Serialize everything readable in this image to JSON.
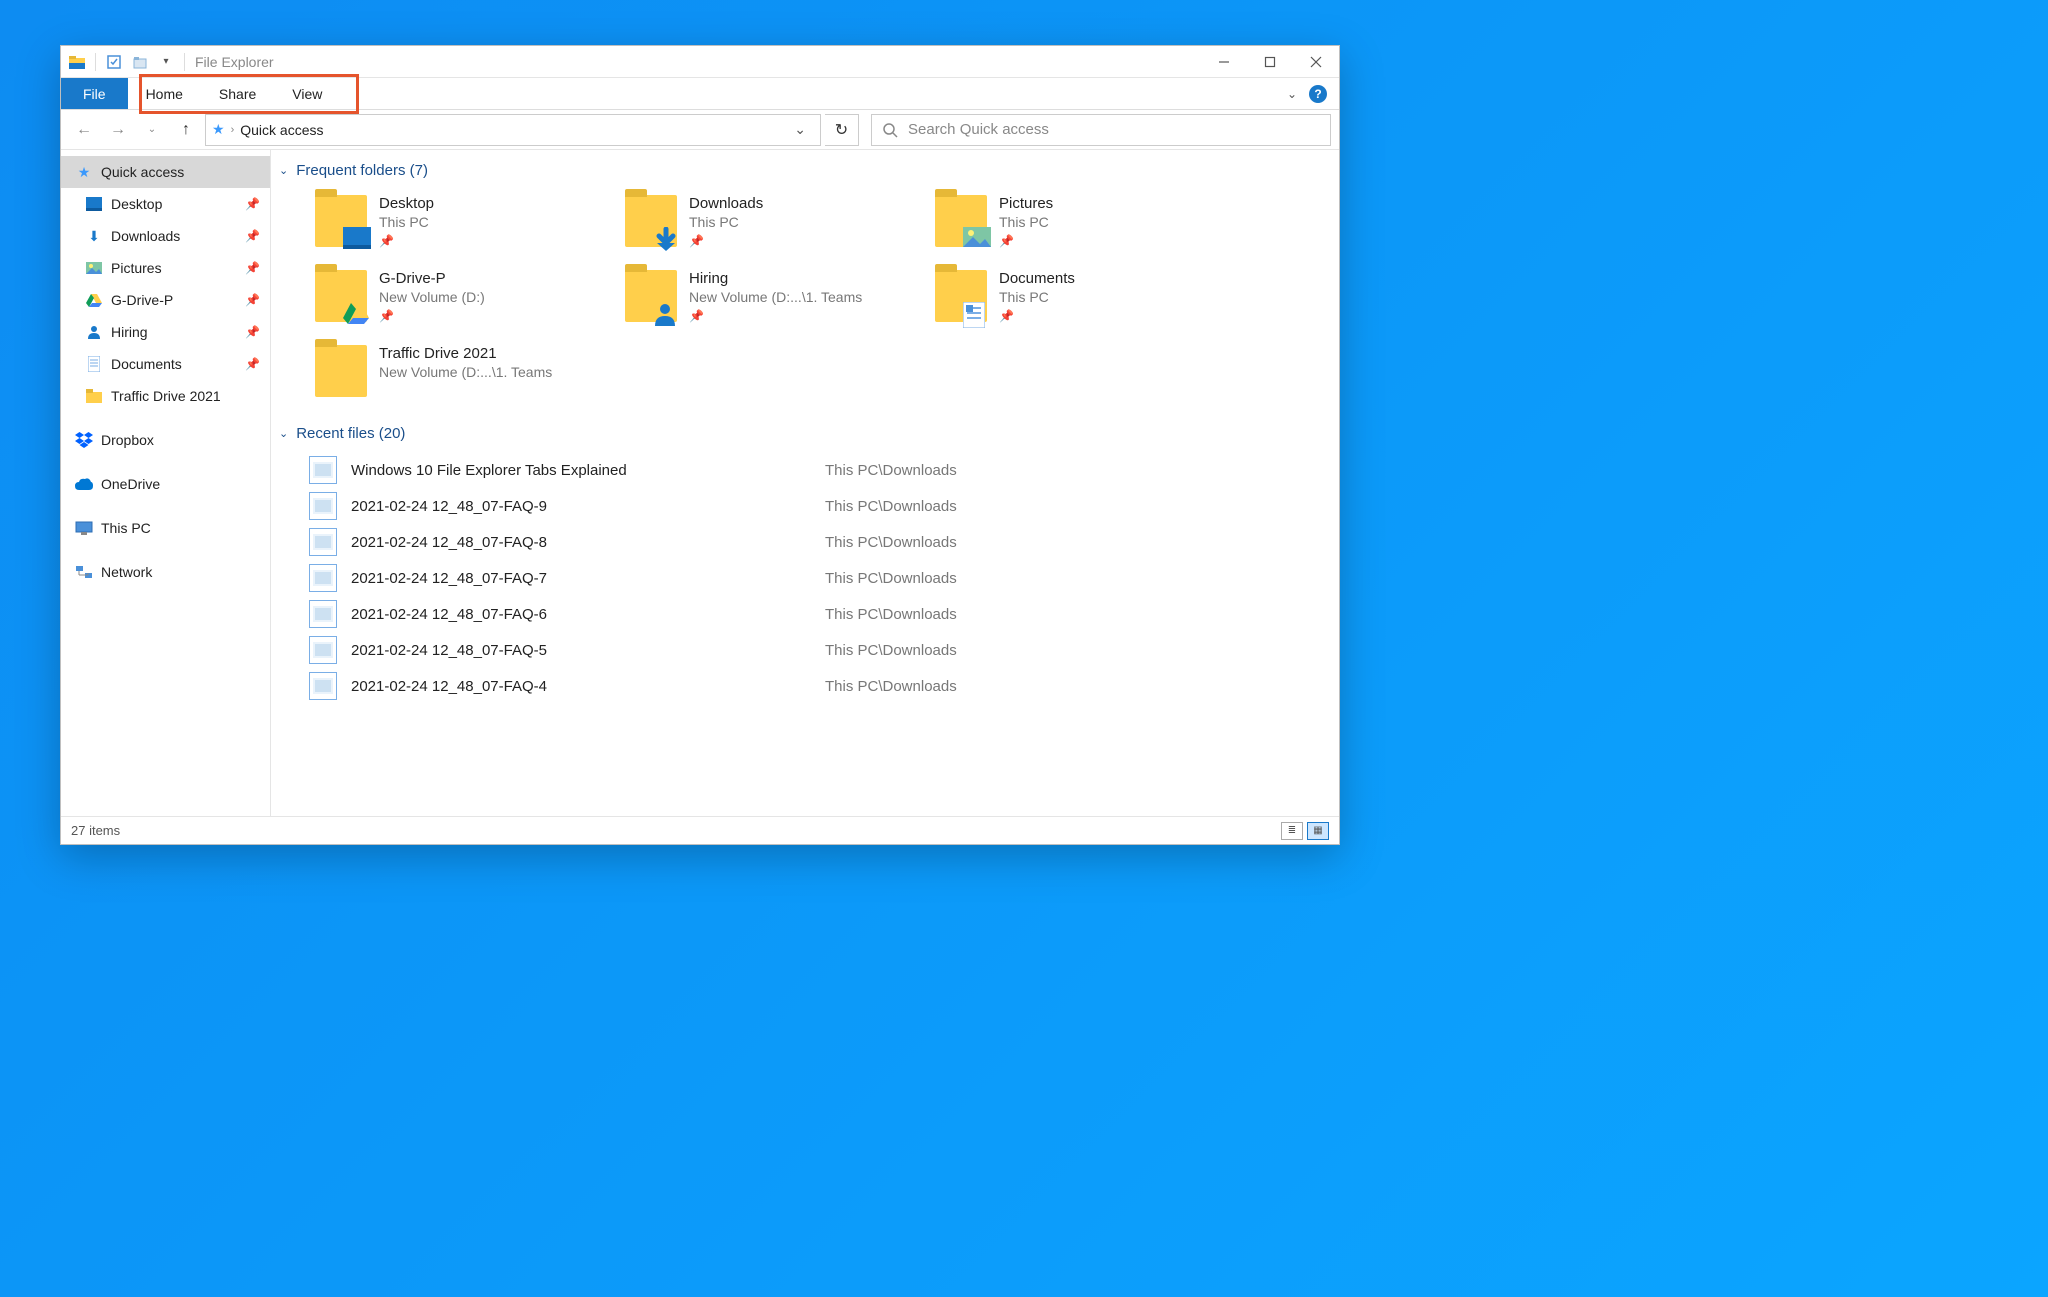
{
  "titlebar": {
    "title": "File Explorer"
  },
  "ribbon": {
    "file": "File",
    "tabs": [
      "Home",
      "Share",
      "View"
    ]
  },
  "nav": {
    "breadcrumb": "Quick access",
    "search_placeholder": "Search Quick access"
  },
  "sidebar": {
    "quick_access": "Quick access",
    "items": [
      {
        "label": "Desktop",
        "pinned": true
      },
      {
        "label": "Downloads",
        "pinned": true
      },
      {
        "label": "Pictures",
        "pinned": true
      },
      {
        "label": "G-Drive-P",
        "pinned": true
      },
      {
        "label": "Hiring",
        "pinned": true
      },
      {
        "label": "Documents",
        "pinned": true
      },
      {
        "label": "Traffic Drive 2021",
        "pinned": false
      }
    ],
    "roots": [
      {
        "label": "Dropbox"
      },
      {
        "label": "OneDrive"
      },
      {
        "label": "This PC"
      },
      {
        "label": "Network"
      }
    ]
  },
  "groups": {
    "frequent_label": "Frequent folders (7)",
    "recent_label": "Recent files (20)"
  },
  "frequent": [
    {
      "name": "Desktop",
      "loc": "This PC",
      "pinned": true,
      "overlay": "desktop"
    },
    {
      "name": "Downloads",
      "loc": "This PC",
      "pinned": true,
      "overlay": "download"
    },
    {
      "name": "Pictures",
      "loc": "This PC",
      "pinned": true,
      "overlay": "picture"
    },
    {
      "name": "G-Drive-P",
      "loc": "New Volume (D:)",
      "pinned": true,
      "overlay": "gdrive"
    },
    {
      "name": "Hiring",
      "loc": "New Volume (D:...\\1. Teams",
      "pinned": true,
      "overlay": "person"
    },
    {
      "name": "Documents",
      "loc": "This PC",
      "pinned": true,
      "overlay": "document"
    },
    {
      "name": "Traffic Drive 2021",
      "loc": "New Volume (D:...\\1. Teams",
      "pinned": false,
      "overlay": "none"
    }
  ],
  "recent": [
    {
      "name": "Windows 10 File Explorer Tabs Explained",
      "loc": "This PC\\Downloads"
    },
    {
      "name": "2021-02-24 12_48_07-FAQ-9",
      "loc": "This PC\\Downloads"
    },
    {
      "name": "2021-02-24 12_48_07-FAQ-8",
      "loc": "This PC\\Downloads"
    },
    {
      "name": "2021-02-24 12_48_07-FAQ-7",
      "loc": "This PC\\Downloads"
    },
    {
      "name": "2021-02-24 12_48_07-FAQ-6",
      "loc": "This PC\\Downloads"
    },
    {
      "name": "2021-02-24 12_48_07-FAQ-5",
      "loc": "This PC\\Downloads"
    },
    {
      "name": "2021-02-24 12_48_07-FAQ-4",
      "loc": "This PC\\Downloads"
    }
  ],
  "status": {
    "count_label": "27 items"
  }
}
